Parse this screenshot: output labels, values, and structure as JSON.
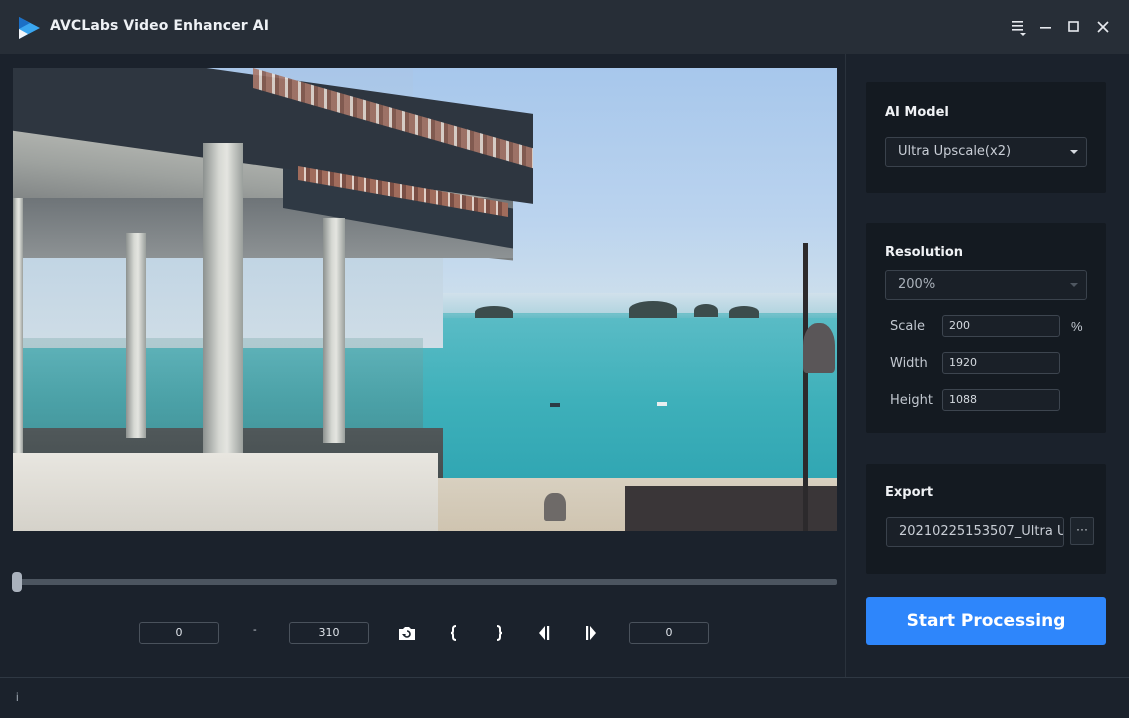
{
  "window": {
    "title": "AVCLabs Video Enhancer AI",
    "controls": {
      "menu_icon": "hamburger-menu-icon",
      "minimize_icon": "minimize-icon",
      "maximize_icon": "maximize-icon",
      "close_icon": "close-icon"
    }
  },
  "preview": {
    "scene_description": "Seaside pavilion terrace overlooking turquoise sea with small islands",
    "timeline": {
      "position_fraction": 0.0
    },
    "range": {
      "start_frame": "0",
      "separator": "-",
      "end_frame": "310"
    },
    "current_frame": "0",
    "controls": [
      {
        "name": "snapshot",
        "icon": "camera-icon"
      },
      {
        "name": "mark-in",
        "icon": "left-brace-icon"
      },
      {
        "name": "mark-out",
        "icon": "right-brace-icon"
      },
      {
        "name": "previous-frame",
        "icon": "step-back-icon"
      },
      {
        "name": "next-frame",
        "icon": "step-forward-icon"
      }
    ]
  },
  "settings": {
    "ai_model": {
      "title": "AI Model",
      "selected": "Ultra Upscale(x2)"
    },
    "resolution": {
      "title": "Resolution",
      "selected": "200%",
      "scale_label": "Scale",
      "scale_value": "200",
      "scale_unit": "%",
      "width_label": "Width",
      "width_value": "1920",
      "height_label": "Height",
      "height_value": "1088"
    },
    "export": {
      "title": "Export",
      "filename": "20210225153507_Ultra U",
      "browse_label": "···"
    },
    "start_button": "Start Processing"
  },
  "status": {
    "text": "i"
  },
  "colors": {
    "accent": "#2e86fb",
    "titlebar": "#272e37",
    "background": "#1b222c",
    "card": "#141a21"
  }
}
